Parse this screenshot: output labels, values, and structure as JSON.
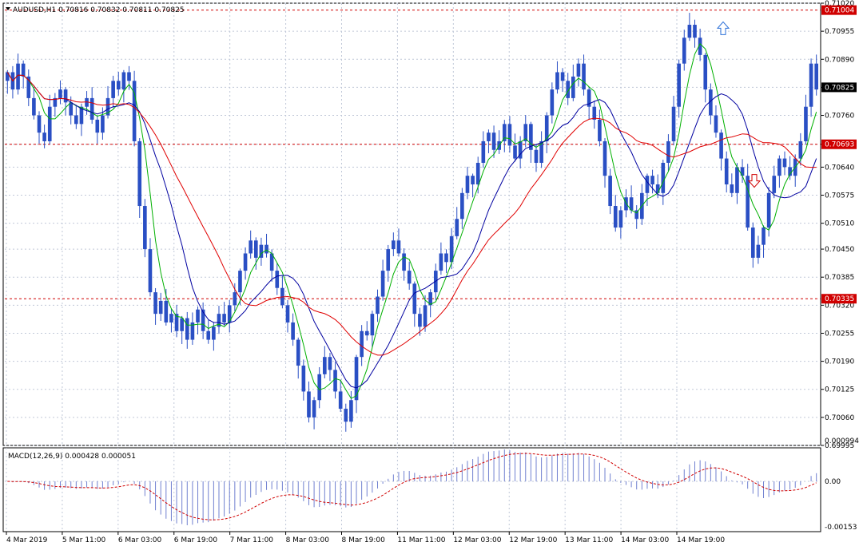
{
  "chart_header": {
    "symbol_info": "AUDUSD,H1  0.70816 0.70832 0.70811 0.70825",
    "menu_icon": "triangle-down-icon"
  },
  "macd_header": {
    "label": "MACD(12,26,9) 0.000428 0.000051"
  },
  "colors": {
    "candle": "#2a4fc4",
    "ma_fast": "#00b000",
    "ma_mid": "#0000a0",
    "ma_slow": "#e00000",
    "level_line": "#d00000",
    "macd_hist": "#7080d0",
    "macd_signal": "#d00000",
    "grid": "#c0c8d8",
    "current_price_box": "#000000",
    "level_box": "#d00000"
  },
  "chart_data": {
    "type": "candlestick",
    "price_axis": {
      "range": [
        0.69995,
        0.7102
      ],
      "ticks": [
        "0.71020",
        "0.70955",
        "0.70890",
        "0.70825",
        "0.70760",
        "0.70693",
        "0.70640",
        "0.70575",
        "0.70510",
        "0.70450",
        "0.70385",
        "0.70320",
        "0.70255",
        "0.70190",
        "0.70125",
        "0.70060",
        "0.69995"
      ]
    },
    "time_axis": {
      "ticks": [
        "4 Mar 2019",
        "5 Mar 11:00",
        "6 Mar 03:00",
        "6 Mar 19:00",
        "7 Mar 11:00",
        "8 Mar 03:00",
        "8 Mar 19:00",
        "11 Mar 11:00",
        "12 Mar 03:00",
        "12 Mar 19:00",
        "13 Mar 11:00",
        "14 Mar 03:00",
        "14 Mar 19:00"
      ]
    },
    "current_price": "0.70825",
    "levels": [
      "0.71004",
      "0.70693",
      "0.70335"
    ],
    "arrows": [
      {
        "direction": "up",
        "icon": "up-arrow-icon",
        "price": 0.7096
      },
      {
        "direction": "down",
        "icon": "down-arrow-icon",
        "price": 0.7061
      }
    ],
    "closes": [
      0.7086,
      0.7082,
      0.7088,
      0.7085,
      0.708,
      0.7076,
      0.7072,
      0.707,
      0.7078,
      0.708,
      0.7082,
      0.7079,
      0.7076,
      0.7074,
      0.7078,
      0.708,
      0.7075,
      0.7072,
      0.7076,
      0.708,
      0.7084,
      0.7082,
      0.7086,
      0.7084,
      0.707,
      0.7055,
      0.7045,
      0.7035,
      0.703,
      0.7033,
      0.7028,
      0.703,
      0.7026,
      0.7029,
      0.7024,
      0.7028,
      0.7031,
      0.7026,
      0.7024,
      0.7027,
      0.703,
      0.7028,
      0.7032,
      0.7035,
      0.704,
      0.7044,
      0.7047,
      0.7043,
      0.7046,
      0.7044,
      0.704,
      0.7036,
      0.7032,
      0.7028,
      0.7024,
      0.7018,
      0.7012,
      0.7006,
      0.701,
      0.7016,
      0.702,
      0.7017,
      0.7012,
      0.7008,
      0.7005,
      0.701,
      0.702,
      0.7026,
      0.7025,
      0.703,
      0.7034,
      0.704,
      0.7045,
      0.7047,
      0.7044,
      0.704,
      0.7037,
      0.703,
      0.7027,
      0.7032,
      0.7035,
      0.704,
      0.7044,
      0.7042,
      0.7048,
      0.7052,
      0.7058,
      0.7062,
      0.706,
      0.7065,
      0.707,
      0.7072,
      0.7068,
      0.707,
      0.7074,
      0.7069,
      0.7066,
      0.707,
      0.7074,
      0.7068,
      0.7065,
      0.707,
      0.7076,
      0.7082,
      0.7086,
      0.7084,
      0.708,
      0.7085,
      0.7088,
      0.7082,
      0.7078,
      0.7075,
      0.707,
      0.7062,
      0.7055,
      0.705,
      0.7054,
      0.7057,
      0.7054,
      0.7052,
      0.7058,
      0.7062,
      0.706,
      0.7058,
      0.7065,
      0.707,
      0.7078,
      0.7088,
      0.7094,
      0.7097,
      0.7094,
      0.709,
      0.7082,
      0.7076,
      0.7072,
      0.7066,
      0.706,
      0.7058,
      0.7064,
      0.7062,
      0.705,
      0.7043,
      0.7046,
      0.705,
      0.7058,
      0.7062,
      0.7066,
      0.7064,
      0.7062,
      0.7066,
      0.707,
      0.7078,
      0.7088,
      0.7082
    ]
  }
}
